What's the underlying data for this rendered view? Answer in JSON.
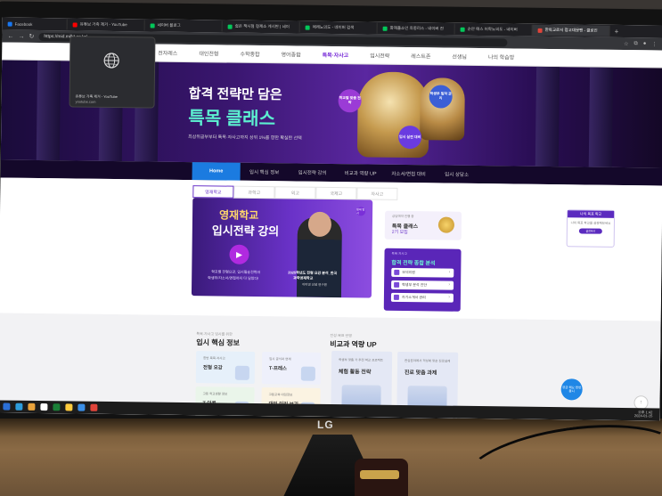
{
  "browser": {
    "tabs": [
      {
        "label": "Facebook",
        "color": "#1877f2",
        "active": false
      },
      {
        "label": "유튜브 가족 제거 - YouTube",
        "color": "#ff0000",
        "active": false
      },
      {
        "label": "네이버 블로그",
        "color": "#03c75a",
        "active": false
      },
      {
        "label": "쉽은 책시점 형제소 게시판 | 네이",
        "color": "#03c75a",
        "active": false
      },
      {
        "label": "에레노의도 - 네이버 검색",
        "color": "#03c75a",
        "active": false
      },
      {
        "label": "화재플소인 최종리스 - 네이버 전",
        "color": "#03c75a",
        "active": false
      },
      {
        "label": "순안 매스 어학노의도 - 네이버",
        "color": "#03c75a",
        "active": false
      },
      {
        "label": "한독교로서 접고대문팬 - 클로인",
        "color": "#e0443a",
        "active": true
      }
    ],
    "new_tab": "+",
    "url": "https://mid.milkt.co.kr/",
    "tooltip_title": "유튜브 가족 제거 - YouTube",
    "tooltip_domain": "youtube.com"
  },
  "site_nav": [
    "전자레스",
    "대인전형",
    "수학종합",
    "영어종합",
    "특목·자사고",
    "입시전략",
    "레스트존",
    "선생님",
    "나의 학습방"
  ],
  "site_nav_active": 4,
  "hero": {
    "subtitle": "합격 전략만 담은",
    "title": "특목 클래스",
    "desc": "최상위공부부터 특목·자사고까지 상위 1%를 향한 확실한 선택",
    "bubbles": [
      {
        "text": "학교별 맞춤 전략",
        "color": "#9b3bd6"
      },
      {
        "text": "학생부 밀착 관리",
        "color": "#3b5fd6"
      },
      {
        "text": "입시 실전 대비",
        "color": "#6a3be0"
      }
    ]
  },
  "menubar": [
    "Home",
    "입시 핵심 정보",
    "입시전략 강의",
    "비교과 역량 UP",
    "자소서/면접 대비",
    "입시 상담소"
  ],
  "subtabs": [
    "영재학교",
    "과학고",
    "외고",
    "국제고",
    "자사고"
  ],
  "banner": {
    "title1": "영재학교",
    "title2": "입시전략 강의",
    "desc1": "학교별 전형요강, 입시필승전략과",
    "desc2": "학생부/자소서/면접까지 다 담았다!",
    "cap1": "2025학년도 전형 요강 분석_한국",
    "cap2": "과학영재학교",
    "cap3": "이미영 선생 연구원",
    "badge": "영재 입시"
  },
  "card1": {
    "label": "상담예약 진행 중",
    "title": "특목 클래스",
    "subtitle": "2기 모집"
  },
  "card2": {
    "label": "특목·자사고",
    "title": "합격 전략 종합 분석",
    "items": [
      "모의지원",
      "학생부 분석 진단",
      "자기소개서 관리"
    ]
  },
  "side": {
    "header": "나의 목표 학교",
    "text": "나의 목표 학교를 설정해보세요",
    "button": "설정하기"
  },
  "section1": {
    "caption": "특목·자사고 입시를 위한",
    "title": "입시 핵심 정보",
    "tiles": [
      {
        "label": "한번 목목·자사고",
        "title": "전형 요강",
        "bg": "#e6f0fa"
      },
      {
        "label": "입시 공식과 연계",
        "title": "T-프레스",
        "bg": "#eef0fb"
      },
      {
        "label": "고등 학교생활 정보",
        "title": "T-더콘",
        "bg": "#eaf5ea"
      },
      {
        "label": "고등교육 대입정보",
        "title": "대입 미리 보기",
        "bg": "#fbf3e2"
      }
    ]
  },
  "section2": {
    "caption": "전성·목표 반영",
    "title": "비교과 역량 UP",
    "tiles": [
      {
        "label": "학생부 맞춤 가 추천 학교 프로젝트",
        "title": "체험 활동 전략"
      },
      {
        "label": "관심분야에서 적성에 맞춘 진로설계",
        "title": "진로 맞춤 과제"
      }
    ]
  },
  "float_button": "궁금 해요 한번 봅니",
  "scroll_top": "↑",
  "taskbar": {
    "icons": [
      "#2b6fd6",
      "#2d9cdb",
      "#e8a23b",
      "#ffffff",
      "#1a7f37",
      "#ffcb3d",
      "#3a8ee6",
      "#e0443a"
    ],
    "tray": "오후 1:42\n2024-01-15"
  },
  "monitor_logo": "LG"
}
